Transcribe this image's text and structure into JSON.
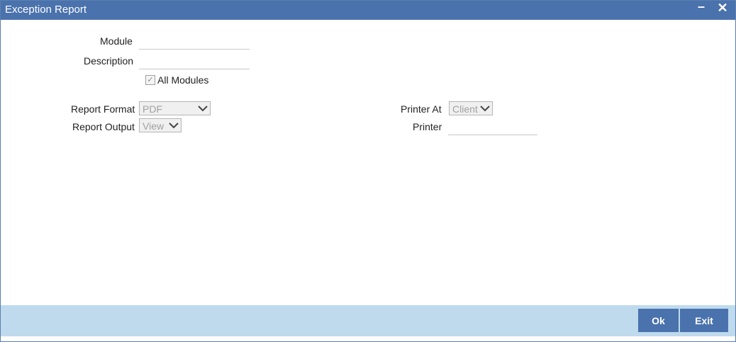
{
  "window": {
    "title": "Exception Report",
    "minimize_glyph": "–",
    "close_glyph": "✕"
  },
  "form": {
    "module_label": "Module",
    "module_value": "",
    "description_label": "Description",
    "description_value": "",
    "all_modules_label": "All Modules",
    "all_modules_checked": true,
    "report_format_label": "Report Format",
    "report_format_value": "PDF",
    "report_output_label": "Report Output",
    "report_output_value": "View",
    "printer_at_label": "Printer At",
    "printer_at_value": "Client",
    "printer_label": "Printer",
    "printer_value": ""
  },
  "footer": {
    "ok_label": "Ok",
    "exit_label": "Exit"
  },
  "colors": {
    "titlebar": "#4a72ad",
    "footer": "#bfdaed",
    "button": "#4a72ad"
  }
}
